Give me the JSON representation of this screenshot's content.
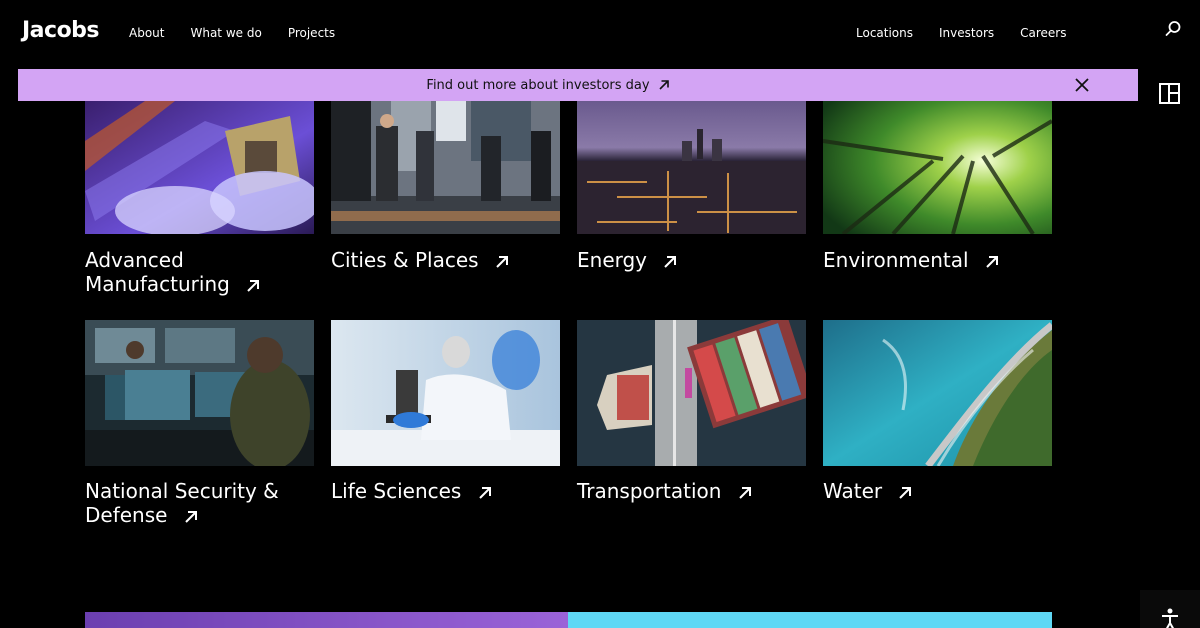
{
  "header": {
    "logo": "Jacobs",
    "nav_left": [
      {
        "label": "About"
      },
      {
        "label": "What we do"
      },
      {
        "label": "Projects"
      }
    ],
    "nav_right": [
      {
        "label": "Locations"
      },
      {
        "label": "Investors"
      },
      {
        "label": "Careers"
      }
    ],
    "search_icon": "search-icon"
  },
  "banner": {
    "text": "Find out more about investors day",
    "background": "#d3a4f4",
    "close_icon": "close-icon"
  },
  "tiles": [
    {
      "line1": "Advanced",
      "line2": "Manufacturing"
    },
    {
      "line1": "Cities & Places"
    },
    {
      "line1": "Energy"
    },
    {
      "line1": "Environmental"
    },
    {
      "line1": "National Security &",
      "line2": "Defense"
    },
    {
      "line1": "Life Sciences"
    },
    {
      "line1": "Transportation"
    },
    {
      "line1": "Water"
    }
  ],
  "colors": {
    "background": "#000000",
    "accent_purple": "#d3a4f4",
    "accent_cyan": "#5fd8f5"
  }
}
